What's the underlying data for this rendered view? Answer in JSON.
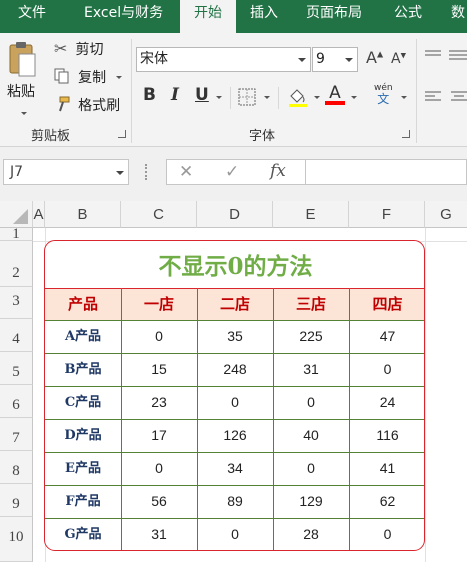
{
  "tabs": [
    {
      "label": "文件"
    },
    {
      "label": "Excel与财务"
    },
    {
      "label": "开始",
      "active": true
    },
    {
      "label": "插入"
    },
    {
      "label": "页面布局"
    },
    {
      "label": "公式"
    },
    {
      "label": "数"
    }
  ],
  "clipboard": {
    "paste_label": "粘贴",
    "cut_label": "剪切",
    "copy_label": "复制",
    "format_painter_label": "格式刷",
    "group_label": "剪贴板"
  },
  "font": {
    "font_name": "宋体",
    "font_size": "9",
    "grow_label": "A",
    "shrink_label": "A",
    "bold_label": "B",
    "italic_label": "I",
    "underline_label": "U",
    "font_color_label": "A",
    "phonetic_top": "wén",
    "phonetic_bottom": "文",
    "group_label": "字体"
  },
  "formula_bar": {
    "name_box": "J7",
    "cancel_symbol": "✕",
    "enter_symbol": "✓",
    "fx_label": "fx",
    "formula": ""
  },
  "sheet": {
    "columns": [
      "A",
      "B",
      "C",
      "D",
      "E",
      "F",
      "G"
    ],
    "rows": [
      "1",
      "2",
      "3",
      "4",
      "5",
      "6",
      "7",
      "8",
      "9",
      "10"
    ],
    "table_title": "不显示0的方法",
    "headers": [
      "产品",
      "一店",
      "二店",
      "三店",
      "四店"
    ],
    "data": [
      [
        "A产品",
        "0",
        "35",
        "225",
        "47"
      ],
      [
        "B产品",
        "15",
        "248",
        "31",
        "0"
      ],
      [
        "C产品",
        "23",
        "0",
        "0",
        "24"
      ],
      [
        "D产品",
        "17",
        "126",
        "40",
        "116"
      ],
      [
        "E产品",
        "0",
        "34",
        "0",
        "41"
      ],
      [
        "F产品",
        "56",
        "89",
        "129",
        "62"
      ],
      [
        "G产品",
        "31",
        "0",
        "28",
        "0"
      ]
    ]
  },
  "colors": {
    "ribbon_green": "#217346",
    "title_green": "#70ad47",
    "header_fill": "#fce4d6",
    "header_text": "#c00000",
    "border_red": "#d9262e"
  }
}
